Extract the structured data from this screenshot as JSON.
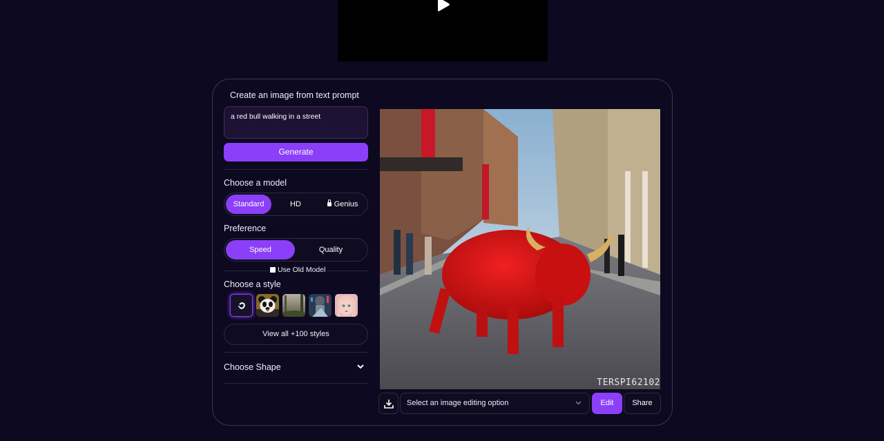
{
  "video": {
    "play_icon": "play-icon"
  },
  "generator": {
    "title": "Create an image from text prompt",
    "prompt_value": "a red bull walking in a street",
    "generate_label": "Generate"
  },
  "model": {
    "label": "Choose a model",
    "options": [
      {
        "label": "Standard",
        "active": true,
        "locked": false
      },
      {
        "label": "HD",
        "active": false,
        "locked": false
      },
      {
        "label": "Genius",
        "active": false,
        "locked": true
      }
    ]
  },
  "preference": {
    "label": "Preference",
    "options": [
      {
        "label": "Speed",
        "active": true
      },
      {
        "label": "Quality",
        "active": false
      }
    ]
  },
  "old_model": {
    "label": "Use Old Model",
    "checked": false
  },
  "style": {
    "label": "Choose a style",
    "thumbnails": [
      "none-style",
      "panda",
      "forest-landscape",
      "cyber-robot",
      "anime-girl"
    ],
    "view_all_label": "View all +100 styles"
  },
  "shape": {
    "label": "Choose Shape"
  },
  "result": {
    "image_alt": "a red bull walking in a street",
    "watermark": "TERSPI62102"
  },
  "actions": {
    "download_icon": "download-icon",
    "select_placeholder": "Select an image editing option",
    "edit_label": "Edit",
    "share_label": "Share"
  },
  "colors": {
    "accent": "#8b3ff8",
    "background": "#0c0920"
  }
}
